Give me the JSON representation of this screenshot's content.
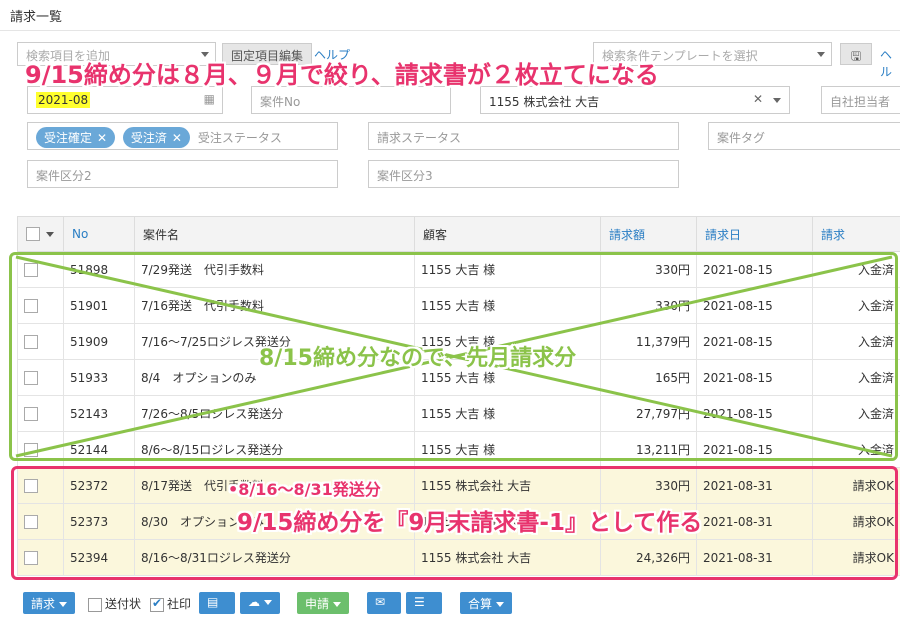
{
  "page_title": "請求一覧",
  "toolbar": {
    "search_add_placeholder": "検索項目を追加",
    "fixed_edit_label": "固定項目編集",
    "help_label": "ヘルプ",
    "template_placeholder": "検索条件テンプレートを選択",
    "help_right_label": "ヘル"
  },
  "filters": {
    "month": "2021-08",
    "case_no_placeholder": "案件No",
    "customer": "1155 株式会社 大吉",
    "owner_placeholder": "自社担当者",
    "tags": [
      {
        "label": "受注確定"
      },
      {
        "label": "受注済"
      }
    ],
    "order_status_placeholder": "受注ステータス",
    "invoice_status_placeholder": "請求ステータス",
    "case_tag_placeholder": "案件タグ",
    "case_div2_placeholder": "案件区分2",
    "case_div3_placeholder": "案件区分3"
  },
  "table": {
    "headers": {
      "no": "No",
      "name": "案件名",
      "customer": "顧客",
      "amount": "請求額",
      "date": "請求日",
      "status": "請求"
    },
    "rows": [
      {
        "no": "51898",
        "name": "7/29発送　代引手数料",
        "customer": "1155 大吉 様",
        "amount": "330円",
        "date": "2021-08-15",
        "status": "入金済"
      },
      {
        "no": "51901",
        "name": "7/16発送　代引手数料",
        "customer": "1155 大吉 様",
        "amount": "330円",
        "date": "2021-08-15",
        "status": "入金済"
      },
      {
        "no": "51909",
        "name": "7/16〜7/25ロジレス発送分",
        "customer": "1155 大吉 様",
        "amount": "11,379円",
        "date": "2021-08-15",
        "status": "入金済"
      },
      {
        "no": "51933",
        "name": "8/4　オプションのみ",
        "customer": "1155 大吉 様",
        "amount": "165円",
        "date": "2021-08-15",
        "status": "入金済"
      },
      {
        "no": "52143",
        "name": "7/26〜8/5ロジレス発送分",
        "customer": "1155 大吉 様",
        "amount": "27,797円",
        "date": "2021-08-15",
        "status": "入金済"
      },
      {
        "no": "52144",
        "name": "8/6〜8/15ロジレス発送分",
        "customer": "1155 大吉 様",
        "amount": "13,211円",
        "date": "2021-08-15",
        "status": "入金済"
      },
      {
        "no": "52372",
        "name": "8/17発送　代引手数料",
        "customer": "1155 株式会社 大吉",
        "amount": "330円",
        "date": "2021-08-31",
        "status": "請求OK"
      },
      {
        "no": "52373",
        "name": "8/30　オプションのみ",
        "customer": "1155 株式会社 大吉",
        "amount": "",
        "date": "2021-08-31",
        "status": "請求OK"
      },
      {
        "no": "52394",
        "name": "8/16〜8/31ロジレス発送分",
        "customer": "1155 株式会社 大吉",
        "amount": "24,326円",
        "date": "2021-08-31",
        "status": "請求OK"
      }
    ]
  },
  "annotations": {
    "top": "9/15締め分は８月、９月で絞り、請求書が２枚立てになる",
    "green": "8/15締め分なので、先月請求分",
    "pink_small": "•8/16〜8/31発送分",
    "pink_big": "9/15締め分を『9月末請求書-1』として作る",
    "colors": {
      "green": "#8bc34a",
      "pink": "#e8336d"
    }
  },
  "bottom": {
    "invoice_btn": "請求",
    "sendslip_label": "送付状",
    "stamp_label": "社印",
    "apply_btn": "申請",
    "merge_btn": "合算"
  }
}
